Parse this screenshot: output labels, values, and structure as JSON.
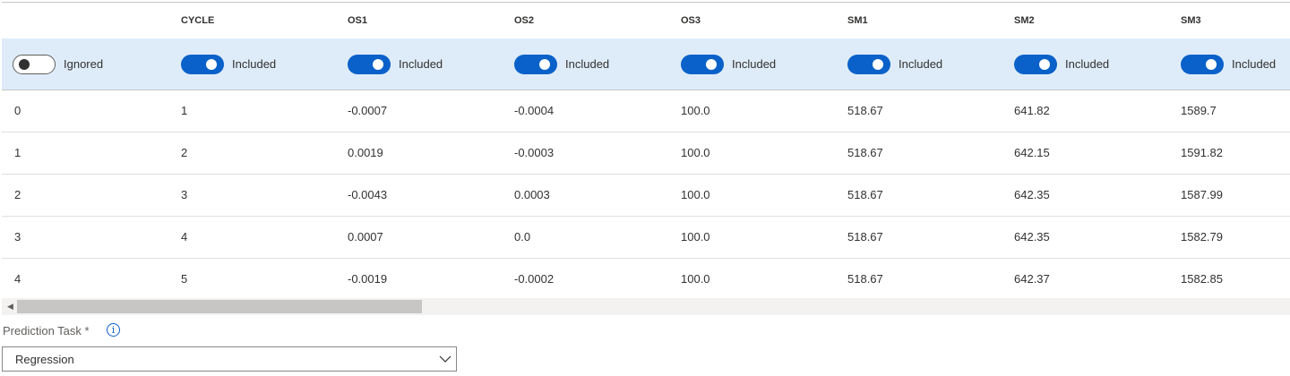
{
  "columns": [
    "",
    "CYCLE",
    "OS1",
    "OS2",
    "OS3",
    "SM1",
    "SM2",
    "SM3"
  ],
  "toggles": [
    {
      "label": "Ignored",
      "on": false
    },
    {
      "label": "Included",
      "on": true
    },
    {
      "label": "Included",
      "on": true
    },
    {
      "label": "Included",
      "on": true
    },
    {
      "label": "Included",
      "on": true
    },
    {
      "label": "Included",
      "on": true
    },
    {
      "label": "Included",
      "on": true
    },
    {
      "label": "Included",
      "on": true
    }
  ],
  "rows": [
    [
      "0",
      "1",
      "-0.0007",
      "-0.0004",
      "100.0",
      "518.67",
      "641.82",
      "1589.7"
    ],
    [
      "1",
      "2",
      "0.0019",
      "-0.0003",
      "100.0",
      "518.67",
      "642.15",
      "1591.82"
    ],
    [
      "2",
      "3",
      "-0.0043",
      "0.0003",
      "100.0",
      "518.67",
      "642.35",
      "1587.99"
    ],
    [
      "3",
      "4",
      "0.0007",
      "0.0",
      "100.0",
      "518.67",
      "642.35",
      "1582.79"
    ],
    [
      "4",
      "5",
      "-0.0019",
      "-0.0002",
      "100.0",
      "518.67",
      "642.37",
      "1582.85"
    ]
  ],
  "prediction_task": {
    "label": "Prediction Task *",
    "info_glyph": "i",
    "value": "Regression"
  },
  "icons": {
    "scroll_left": "scroll-left-arrow-icon",
    "info": "info-icon",
    "dropdown": "chevron-down-icon"
  },
  "colors": {
    "accent": "#0a61c9",
    "toggle_row_bg": "#deecf9"
  }
}
